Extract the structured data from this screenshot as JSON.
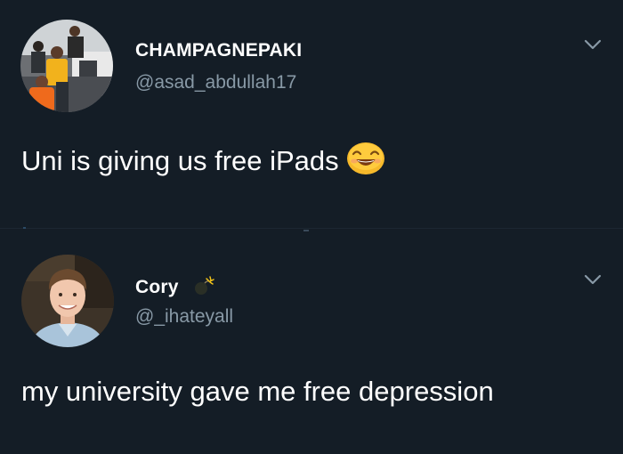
{
  "tweets": [
    {
      "display_name": "CHAMPAGNEPAKI",
      "handle": "@asad_abdullah17",
      "text": "Uni is giving us free iPads",
      "emoji": "smiling-face-with-smiling-eyes",
      "avatar": "group-photo-avatar"
    },
    {
      "display_name": "Cory",
      "handle": "@_ihateyall",
      "text": "my university gave me free depression",
      "badge": "bomb-emoji",
      "avatar": "portrait-photo-avatar"
    }
  ],
  "colors": {
    "background": "#141d26",
    "text_primary": "#ffffff",
    "text_secondary": "#8899a6",
    "chevron": "#8899a6"
  },
  "icons": {
    "more_options": "chevron-down-icon"
  }
}
